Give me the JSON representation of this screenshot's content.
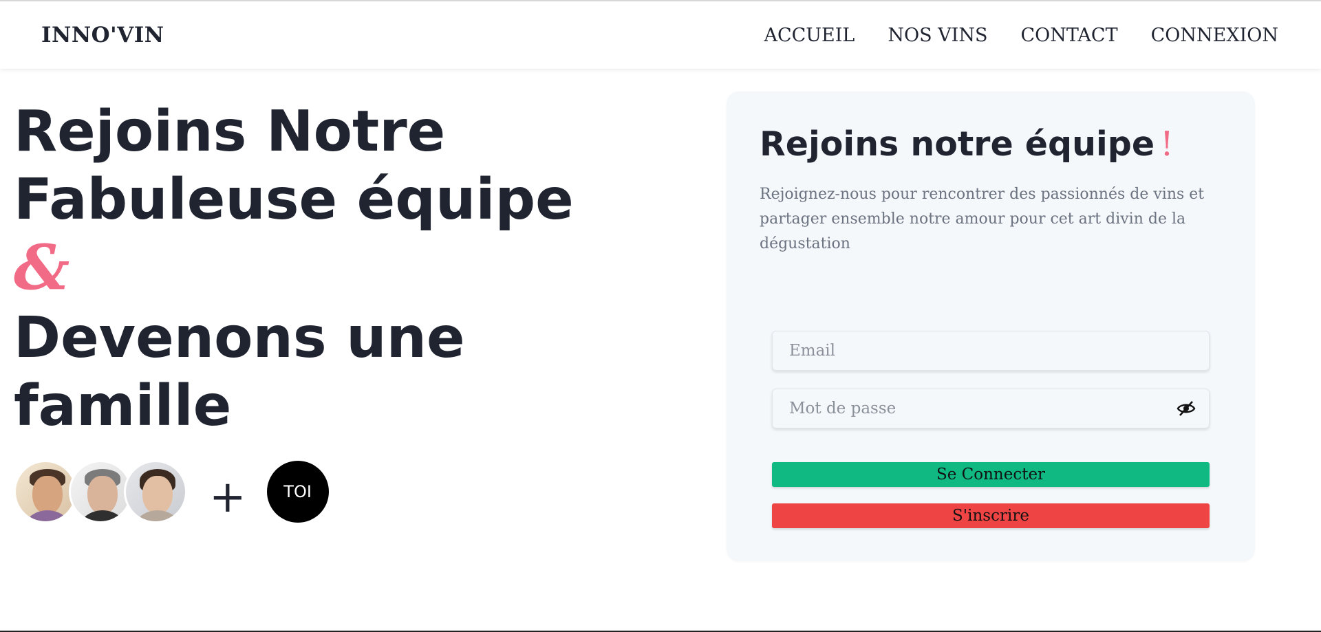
{
  "navbar": {
    "brand": "INNO'VIN",
    "links": [
      {
        "label": "ACCUEIL"
      },
      {
        "label": "NOS VINS"
      },
      {
        "label": "CONTACT"
      },
      {
        "label": "CONNEXION"
      }
    ]
  },
  "hero": {
    "line1": "Rejoins Notre",
    "line2": "Fabuleuse équipe",
    "ampersand": "&",
    "line3": "Devenons une",
    "line4": "famille",
    "plus": "+",
    "toi_label": "TOI",
    "avatars": [
      "avatar-man-smiling",
      "avatar-man-gray-hair",
      "avatar-man-curly-hair"
    ]
  },
  "card": {
    "title": "Rejoins notre équipe",
    "exclaim": "!",
    "description": "Rejoignez-nous pour rencontrer des passionnés de vins et partager ensemble notre amour pour cet art divin de la dégustation",
    "email_placeholder": "Email",
    "password_placeholder": "Mot de passe",
    "password_toggle_icon": "eye-slash-icon",
    "login_label": "Se Connecter",
    "signup_label": "S'inscrire"
  },
  "colors": {
    "accent_pink": "#f26b86",
    "login_green": "#10b981",
    "signup_red": "#ef4444",
    "card_bg": "#f5f8fb",
    "text_dark": "#1f2430"
  }
}
